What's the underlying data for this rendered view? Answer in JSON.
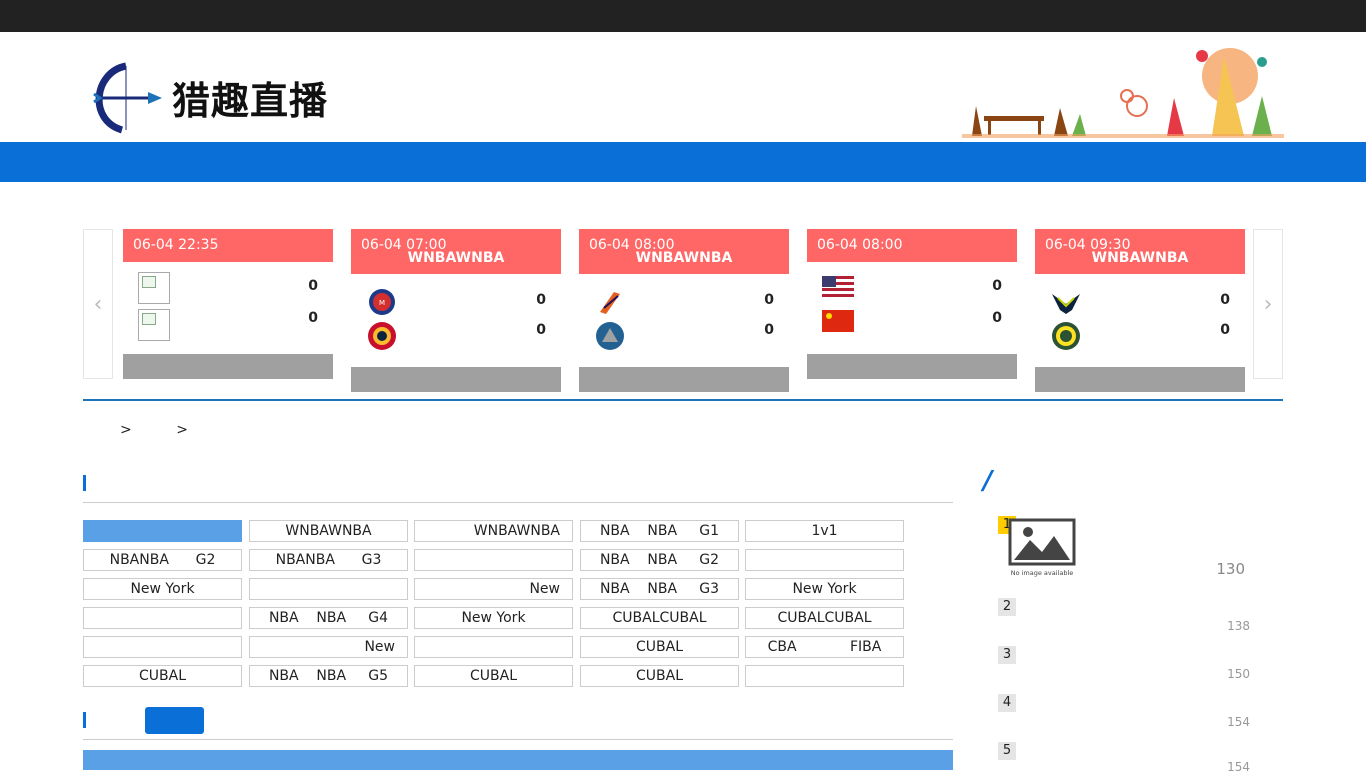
{
  "site": {
    "logo_text": "猎趣直播"
  },
  "slider": {
    "prev_icon": "chevron-left-icon",
    "next_icon": "chevron-right-icon",
    "cards": [
      {
        "time": "06-04 22:35",
        "league": "",
        "home_score": "0",
        "away_score": "0",
        "home_logo": "broken-image-icon",
        "away_logo": "broken-image-icon"
      },
      {
        "time": "06-04 07:00",
        "league": "WNBAWNBA",
        "home_score": "0",
        "away_score": "0",
        "home_logo": "mystics-logo-icon",
        "away_logo": "fever-logo-icon"
      },
      {
        "time": "06-04 08:00",
        "league": "WNBAWNBA",
        "home_score": "0",
        "away_score": "0",
        "home_logo": "mercury-logo-icon",
        "away_logo": "lynx-logo-icon"
      },
      {
        "time": "06-04 08:00",
        "league": "",
        "home_score": "0",
        "away_score": "0",
        "home_logo": "usa-flag-icon",
        "away_logo": "china-flag-icon"
      },
      {
        "time": "06-04 09:30",
        "league": "WNBAWNBA",
        "home_score": "0",
        "away_score": "0",
        "home_logo": "wings-logo-icon",
        "away_logo": "storm-logo-icon"
      }
    ]
  },
  "breadcrumb": {
    "sep1": ">",
    "sep2": ">"
  },
  "tags": [
    [
      "",
      "WNBAWNBA",
      "WNBAWNBA",
      "NBA    NBA     G1",
      "1v1"
    ],
    [
      "NBANBA      G2",
      "NBANBA      G3",
      "",
      "NBA    NBA     G2",
      ""
    ],
    [
      "New York",
      "",
      "New",
      "NBA    NBA     G3",
      "New York"
    ],
    [
      "",
      "NBA    NBA     G4",
      "New York",
      "CUBALCUBAL",
      "CUBALCUBAL"
    ],
    [
      "",
      "New",
      "",
      "CUBAL",
      "CBA            FIBA"
    ],
    [
      "CUBAL",
      "NBA    NBA     G5",
      "CUBAL",
      "CUBAL",
      ""
    ]
  ],
  "sidebar": {
    "title": "/",
    "ranks": [
      {
        "num": "1",
        "count": "130",
        "image": "no-image-icon",
        "image_label": "No image available"
      },
      {
        "num": "2",
        "count": "138"
      },
      {
        "num": "3",
        "count": "150"
      },
      {
        "num": "4",
        "count": "154"
      },
      {
        "num": "5",
        "count": "154"
      }
    ]
  },
  "colors": {
    "topbar": "#222222",
    "navbar": "#0a6fd6",
    "card_head": "#ff6666",
    "card_foot": "#a0a0a0",
    "active_tag": "#5aa0e6",
    "rank_first": "#ffcc00"
  }
}
